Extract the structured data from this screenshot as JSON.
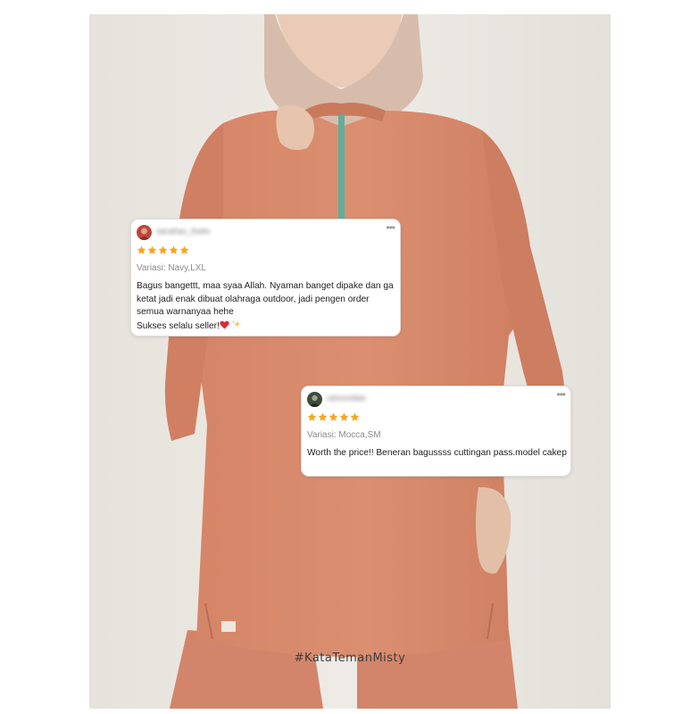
{
  "hashtag": "#KataTemanMisty",
  "reviews": [
    {
      "username": "sanahas_thelis",
      "rating": 5,
      "variant": "Variasi: Navy,LXL",
      "text": "Bagus bangettt, maa syaa Allah. Nyaman banget dipake dan ga ketat jadi enak dibuat olahraga outdoor, jadi pengen order semua warnanyaa hehe\nSukses selalu seller!",
      "avatar_icon": "avatar-photo-icon",
      "end_icons": [
        "heart-icon",
        "sparkle-icon"
      ]
    },
    {
      "username": "rahmmiilah",
      "rating": 5,
      "variant": "Variasi: Mocca,SM",
      "text": "Worth the price!! Beneran bagussss cuttingan pass.model cakep",
      "avatar_icon": "avatar-photo-icon"
    }
  ],
  "colors": {
    "star": "#f5a623",
    "garment": "#d98a6a",
    "hijab": "#d6b8a8",
    "zipper": "#5fae9c",
    "background": "#ebe8e3"
  }
}
